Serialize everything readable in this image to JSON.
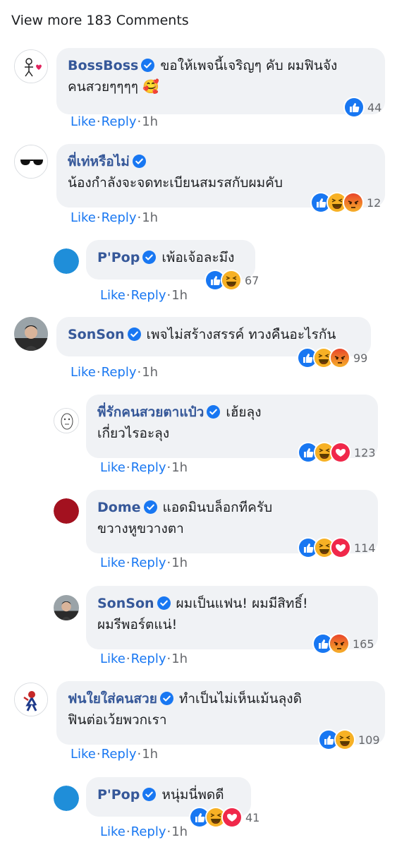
{
  "header": {
    "view_more": "View more 183 Comments"
  },
  "labels": {
    "like": "Like",
    "reply": "Reply",
    "dot": "·"
  },
  "colors": {
    "like_blue": "#1877f2",
    "name_blue": "#365899",
    "bubble": "#f0f2f5",
    "angry_red": "#e9452a",
    "haha_yellow": "#f7b125",
    "love_red": "#f0284a"
  },
  "comments": [
    {
      "name": "BossBoss",
      "text1": "ขอให้เพจนี้เจริญๆ คับ ผมฟินจัง",
      "text2": "คนสวยๆๆๆๆ 🥰",
      "time": "1h",
      "reaction_icons": [
        "like"
      ],
      "reaction_count": "44",
      "avatar": "stick-figure-heart"
    },
    {
      "name": "พี่เท่หรือไม่",
      "text1": "",
      "text2": "น้องกำลังจะจดทะเบียนสมรสกับผมคับ",
      "time": "1h",
      "reaction_icons": [
        "like",
        "haha",
        "angry"
      ],
      "reaction_count": "12",
      "avatar": "sunglasses"
    },
    {
      "name": "P'Pop",
      "text1": "เพ้อเจ้อละมึง",
      "text2": "",
      "time": "1h",
      "reaction_icons": [
        "like",
        "haha"
      ],
      "reaction_count": "67",
      "avatar": "blue-circle"
    },
    {
      "name": "SonSon",
      "text1": "เพจไม่สร้างสรรค์ ทวงคืนอะไรกัน",
      "text2": "",
      "time": "1h",
      "reaction_icons": [
        "like",
        "haha",
        "angry"
      ],
      "reaction_count": "99",
      "avatar": "man-photo"
    },
    {
      "name": "พี่รักคนสวยตาแป๋ว",
      "text1": "เฮ้ยลุง",
      "text2": "เกี่ยวไรอะลุง",
      "time": "1h",
      "reaction_icons": [
        "like",
        "haha",
        "love"
      ],
      "reaction_count": "123",
      "avatar": "sketch-face"
    },
    {
      "name": "Dome",
      "text1": "แอดมินบล็อกทีครับ",
      "text2": "ขวางหูขวางตา",
      "time": "1h",
      "reaction_icons": [
        "like",
        "haha",
        "love"
      ],
      "reaction_count": "114",
      "avatar": "red-circle"
    },
    {
      "name": "SonSon",
      "text1": "ผมเป็นแฟน! ผมมีสิทธิ์!",
      "text2": "ผมรีพอร์ตแน่!",
      "time": "1h",
      "reaction_icons": [
        "like",
        "angry"
      ],
      "reaction_count": "165",
      "avatar": "man-photo"
    },
    {
      "name": "ฟนใยใส่คนสวย",
      "text1": "ทำเป็นไม่เห็นเม้นลุงดิ",
      "text2": "ฟินต่อเว้ยพวกเรา",
      "time": "1h",
      "reaction_icons": [
        "like",
        "haha"
      ],
      "reaction_count": "109",
      "avatar": "spider-figure"
    },
    {
      "name": "P'Pop",
      "text1": "หนุ่มนี่พดดี",
      "text2": "",
      "time": "1h",
      "reaction_icons": [
        "like",
        "haha",
        "love"
      ],
      "reaction_count": "41",
      "avatar": "blue-circle"
    }
  ]
}
